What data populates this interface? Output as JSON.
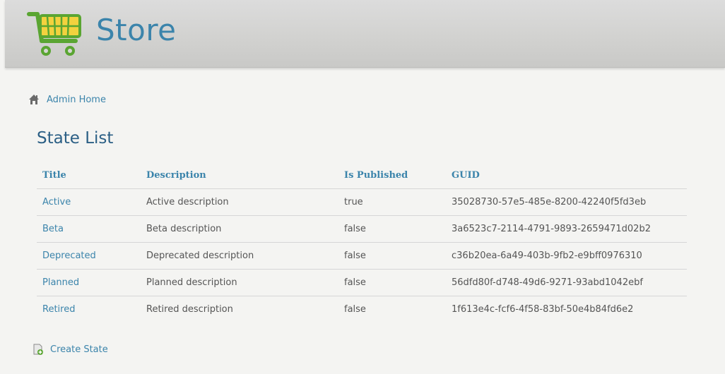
{
  "header": {
    "title": "Store",
    "logo_icon": "shopping-cart-icon"
  },
  "breadcrumb": {
    "icon": "home-icon",
    "label": "Admin Home"
  },
  "page": {
    "title": "State List"
  },
  "table": {
    "columns": [
      "Title",
      "Description",
      "Is Published",
      "GUID"
    ],
    "rows": [
      {
        "title": "Active",
        "description": "Active description",
        "published": "true",
        "guid": "35028730-57e5-485e-8200-42240f5fd3eb"
      },
      {
        "title": "Beta",
        "description": "Beta description",
        "published": "false",
        "guid": "3a6523c7-2114-4791-9893-2659471d02b2"
      },
      {
        "title": "Deprecated",
        "description": "Deprecated description",
        "published": "false",
        "guid": "c36b20ea-6a49-403b-9fb2-e9bff0976310"
      },
      {
        "title": "Planned",
        "description": "Planned description",
        "published": "false",
        "guid": "56dfd80f-d748-49d6-9271-93abd1042ebf"
      },
      {
        "title": "Retired",
        "description": "Retired description",
        "published": "false",
        "guid": "1f613e4c-fcf6-4f58-83bf-50e4b84fd6e2"
      }
    ]
  },
  "actions": {
    "create_label": "Create State",
    "create_icon": "document-add-icon"
  },
  "colors": {
    "link": "#3b84ab",
    "title": "#2b5f85",
    "cart_green": "#5aa532"
  }
}
